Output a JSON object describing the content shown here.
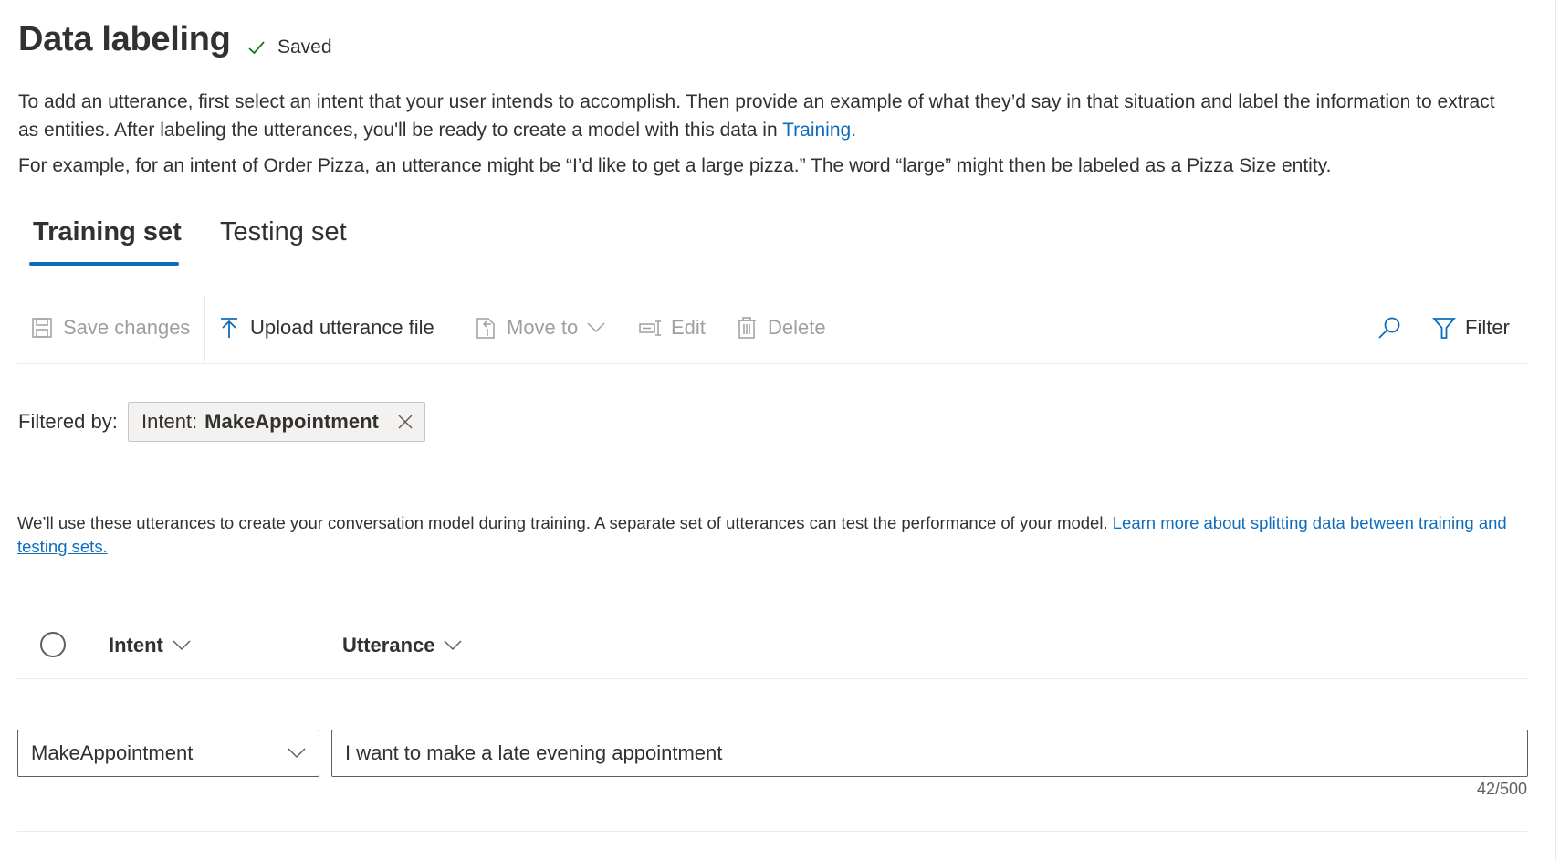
{
  "header": {
    "title": "Data labeling",
    "status": "Saved",
    "status_icon": "checkmark-icon"
  },
  "description": {
    "line1": "To add an utterance, first select an intent that your user intends to accomplish. Then provide an example of what they’d say in that situation and label the information to extract as entities. After labeling the utterances, you'll be ready to create a model with this data in ",
    "link": "Training.",
    "line2": "For example, for an intent of Order Pizza, an utterance might be “I’d like to get a large pizza.” The word “large” might then be labeled as a Pizza Size entity."
  },
  "tabs": [
    {
      "label": "Training set",
      "active": true
    },
    {
      "label": "Testing set",
      "active": false
    }
  ],
  "toolbar": {
    "save_changes": "Save changes",
    "upload": "Upload utterance file",
    "move_to": "Move to",
    "edit": "Edit",
    "delete": "Delete",
    "filter": "Filter"
  },
  "filter": {
    "label": "Filtered by:",
    "chip_key": "Intent:",
    "chip_value": "MakeAppointment"
  },
  "info": {
    "text": "We’ll use these utterances to create your conversation model during training. A separate set of utterances can test the performance of your model. ",
    "link": "Learn more about splitting data between training and testing sets."
  },
  "table": {
    "columns": [
      "Intent",
      "Utterance"
    ],
    "row": {
      "intent": "MakeAppointment",
      "utterance": "I want to make a late evening appointment",
      "counter": "42/500"
    }
  },
  "colors": {
    "accent": "#0f6cbd",
    "success": "#107c10",
    "disabled": "#a19f9d"
  }
}
